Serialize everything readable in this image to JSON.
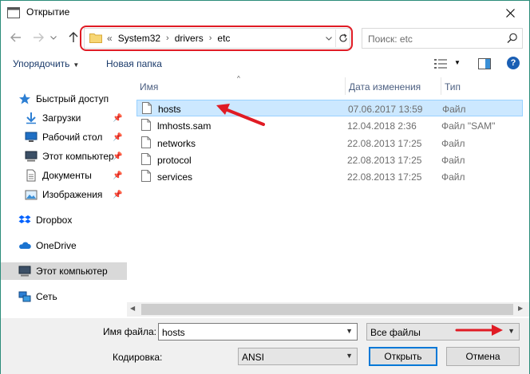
{
  "window": {
    "title": "Открытие"
  },
  "address": {
    "prefix": "«",
    "crumbs": [
      "System32",
      "drivers",
      "etc"
    ]
  },
  "search": {
    "placeholder": "Поиск: etc"
  },
  "toolbar": {
    "organize": "Упорядочить",
    "new_folder": "Новая папка"
  },
  "sidebar": {
    "items": [
      {
        "label": "Быстрый доступ",
        "icon": "star-icon"
      },
      {
        "label": "Загрузки",
        "icon": "download-icon",
        "pinned": true
      },
      {
        "label": "Рабочий стол",
        "icon": "desktop-icon",
        "pinned": true
      },
      {
        "label": "Этот компьютер",
        "icon": "computer-icon",
        "pinned": true
      },
      {
        "label": "Документы",
        "icon": "documents-icon",
        "pinned": true
      },
      {
        "label": "Изображения",
        "icon": "pictures-icon",
        "pinned": true
      },
      {
        "label": "Dropbox",
        "icon": "dropbox-icon"
      },
      {
        "label": "OneDrive",
        "icon": "onedrive-icon"
      },
      {
        "label": "Этот компьютер",
        "icon": "computer-icon",
        "selected": true
      },
      {
        "label": "Сеть",
        "icon": "network-icon"
      }
    ]
  },
  "columns": {
    "name": "Имя",
    "date": "Дата изменения",
    "type": "Тип"
  },
  "files": [
    {
      "name": "hosts",
      "date": "07.06.2017 13:59",
      "type": "Файл",
      "selected": true
    },
    {
      "name": "lmhosts.sam",
      "date": "12.04.2018 2:36",
      "type": "Файл \"SAM\""
    },
    {
      "name": "networks",
      "date": "22.08.2013 17:25",
      "type": "Файл"
    },
    {
      "name": "protocol",
      "date": "22.08.2013 17:25",
      "type": "Файл"
    },
    {
      "name": "services",
      "date": "22.08.2013 17:25",
      "type": "Файл"
    }
  ],
  "bottom": {
    "filename_label": "Имя файла:",
    "filename_value": "hosts",
    "filter_value": "Все файлы",
    "encoding_label": "Кодировка:",
    "encoding_value": "ANSI",
    "open_button": "Открыть",
    "cancel_button": "Отмена"
  },
  "colors": {
    "annotation": "#e01b24",
    "selection": "#cce8ff",
    "accent": "#0078d7"
  }
}
